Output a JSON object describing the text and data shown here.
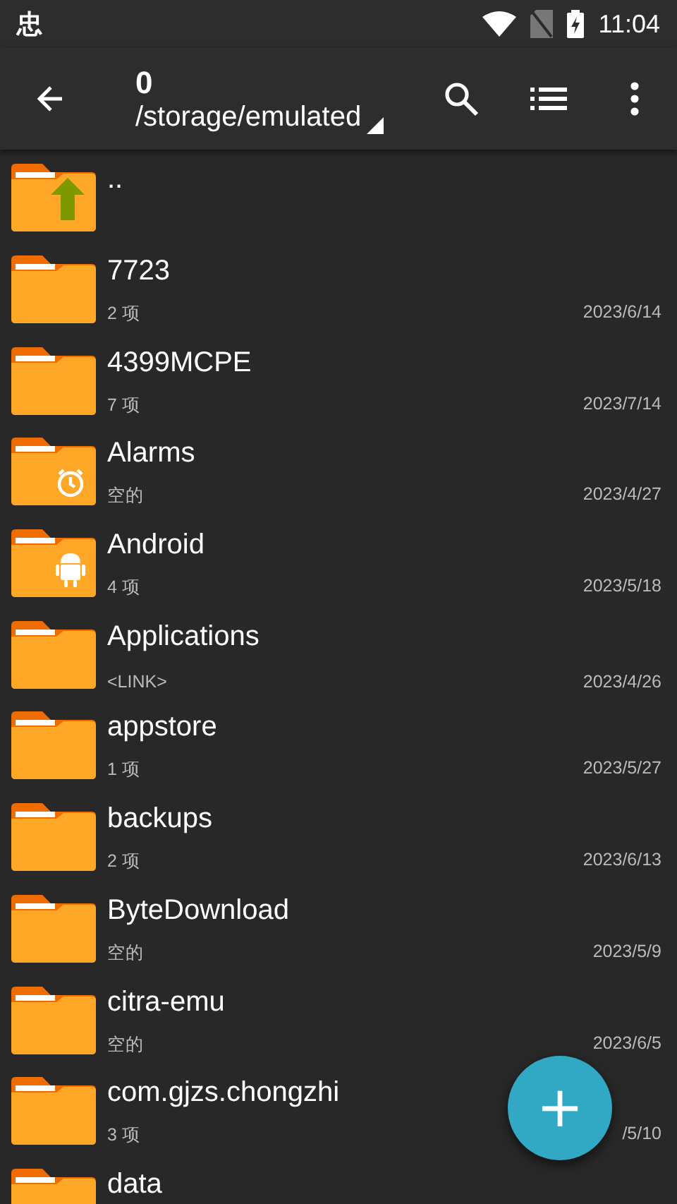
{
  "status_bar": {
    "app_glyph": "忠",
    "time": "11:04"
  },
  "toolbar": {
    "title": "0",
    "path": "/storage/emulated"
  },
  "files": [
    {
      "kind": "up",
      "name": ".."
    },
    {
      "kind": "plain",
      "name": "7723",
      "info": "2 项",
      "date": "2023/6/14"
    },
    {
      "kind": "plain",
      "name": "4399MCPE",
      "info": "7 项",
      "date": "2023/7/14"
    },
    {
      "kind": "alarm",
      "name": "Alarms",
      "info": "空的",
      "date": "2023/4/27"
    },
    {
      "kind": "android",
      "name": "Android",
      "info": "4 项",
      "date": "2023/5/18"
    },
    {
      "kind": "plain",
      "name": "Applications",
      "info": "<LINK>",
      "date": "2023/4/26"
    },
    {
      "kind": "plain",
      "name": "appstore",
      "info": "1 项",
      "date": "2023/5/27"
    },
    {
      "kind": "plain",
      "name": "backups",
      "info": "2 项",
      "date": "2023/6/13"
    },
    {
      "kind": "plain",
      "name": "ByteDownload",
      "info": "空的",
      "date": "2023/5/9"
    },
    {
      "kind": "plain",
      "name": "citra-emu",
      "info": "空的",
      "date": "2023/6/5"
    },
    {
      "kind": "plain",
      "name": "com.gjzs.chongzhi",
      "info": "3 项",
      "date": "/5/10"
    },
    {
      "kind": "plain",
      "name": "data"
    }
  ],
  "fab": {
    "label": "+"
  }
}
